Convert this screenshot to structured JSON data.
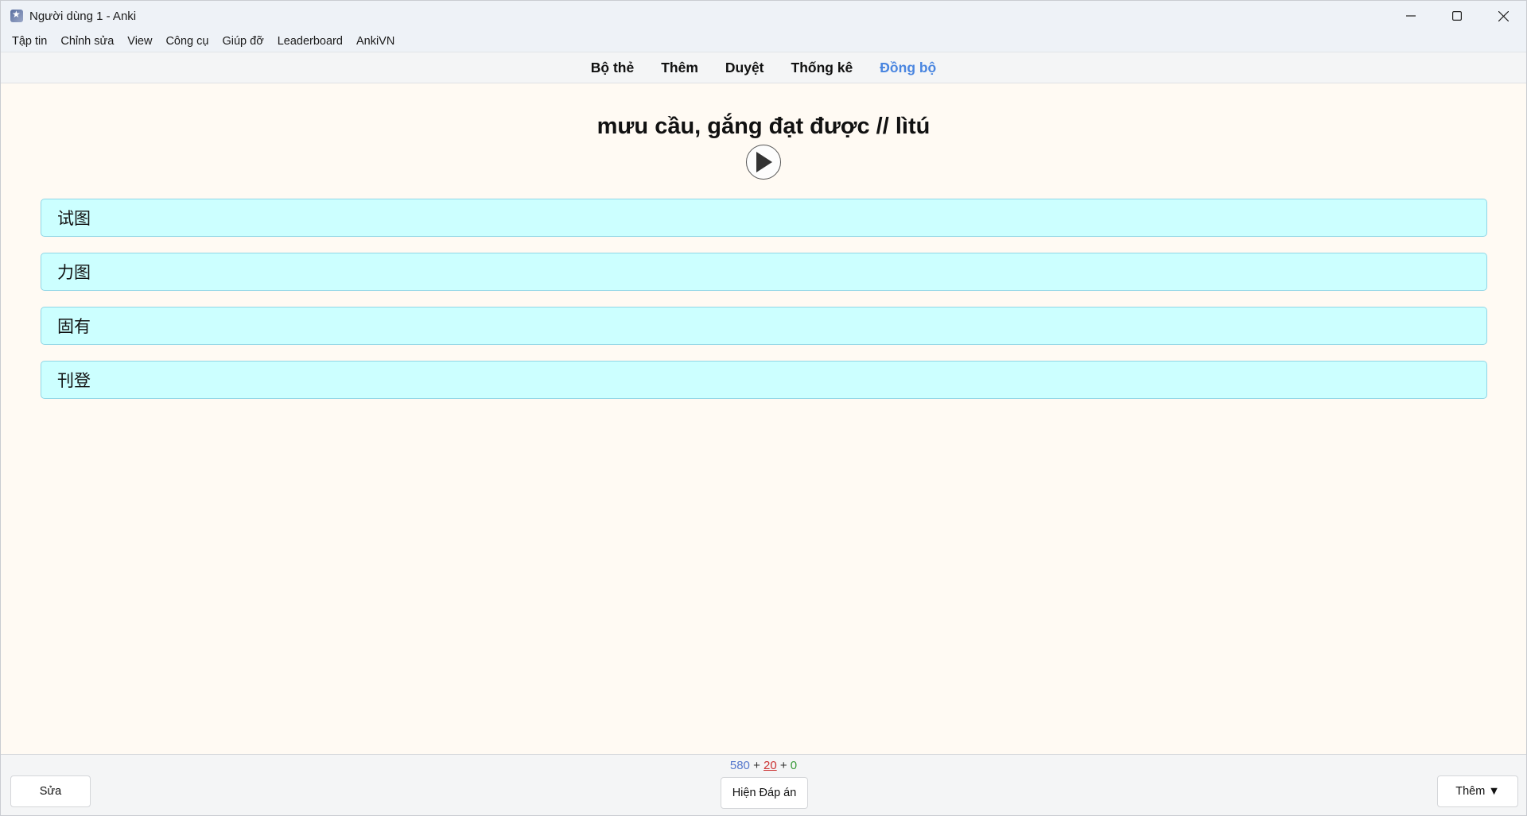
{
  "window": {
    "title": "Người dùng 1 - Anki"
  },
  "menu": [
    {
      "label": "Tập tin"
    },
    {
      "label": "Chỉnh sửa"
    },
    {
      "label": "View"
    },
    {
      "label": "Công cụ"
    },
    {
      "label": "Giúp đỡ"
    },
    {
      "label": "Leaderboard"
    },
    {
      "label": "AnkiVN"
    }
  ],
  "toolbar": {
    "decks": "Bộ thẻ",
    "add": "Thêm",
    "browse": "Duyệt",
    "stats": "Thống kê",
    "sync": "Đồng bộ"
  },
  "card": {
    "question": "mưu cầu, gắng đạt được // lìtú",
    "options": [
      "试图",
      "力图",
      "固有",
      "刊登"
    ]
  },
  "bottom": {
    "counts": {
      "new": "580",
      "learning": "20",
      "review": "0",
      "plus": "+"
    },
    "edit_label": "Sửa",
    "show_answer_label": "Hiện Đáp án",
    "more_label": "Thêm ▼"
  },
  "colors": {
    "sync_accent": "#4a86e0",
    "option_bg": "#ccffff",
    "count_new": "#5577cc",
    "count_learn": "#cc3333",
    "count_review": "#3a9a3a"
  }
}
